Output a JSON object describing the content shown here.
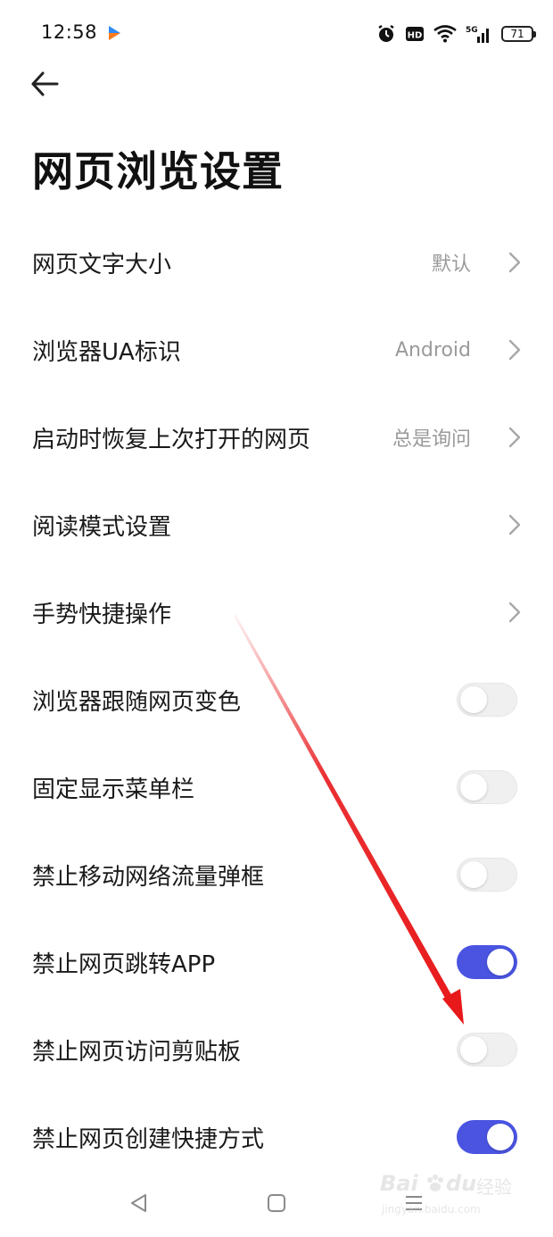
{
  "status_bar": {
    "time": "12:58",
    "signal_label": "5G",
    "hd_label": "HD",
    "battery_level": "71"
  },
  "header": {
    "title": "网页浏览设置"
  },
  "settings": {
    "items": [
      {
        "label": "网页文字大小",
        "value": "默认",
        "type": "nav"
      },
      {
        "label": "浏览器UA标识",
        "value": "Android",
        "type": "nav"
      },
      {
        "label": "启动时恢复上次打开的网页",
        "value": "总是询问",
        "type": "nav"
      },
      {
        "label": "阅读模式设置",
        "value": "",
        "type": "nav"
      },
      {
        "label": "手势快捷操作",
        "value": "",
        "type": "nav"
      },
      {
        "label": "浏览器跟随网页变色",
        "type": "toggle",
        "enabled": false
      },
      {
        "label": "固定显示菜单栏",
        "type": "toggle",
        "enabled": false
      },
      {
        "label": "禁止移动网络流量弹框",
        "type": "toggle",
        "enabled": false
      },
      {
        "label": "禁止网页跳转APP",
        "type": "toggle",
        "enabled": true
      },
      {
        "label": "禁止网页访问剪贴板",
        "type": "toggle",
        "enabled": false
      },
      {
        "label": "禁止网页创建快捷方式",
        "type": "toggle",
        "enabled": true
      }
    ]
  },
  "colors": {
    "accent": "#4a54e1",
    "toggle_off": "#f0f0f0",
    "annotation_arrow": "#e8191b",
    "secondary_text": "#9a9a9a"
  },
  "navigation": {
    "icons": [
      "back-triangle-icon",
      "home-square-icon",
      "menu-lines-icon"
    ]
  },
  "watermark": {
    "brand": "Bai",
    "brand_suffix": "du",
    "product": "经验",
    "url": "jingyan.baidu.com"
  }
}
